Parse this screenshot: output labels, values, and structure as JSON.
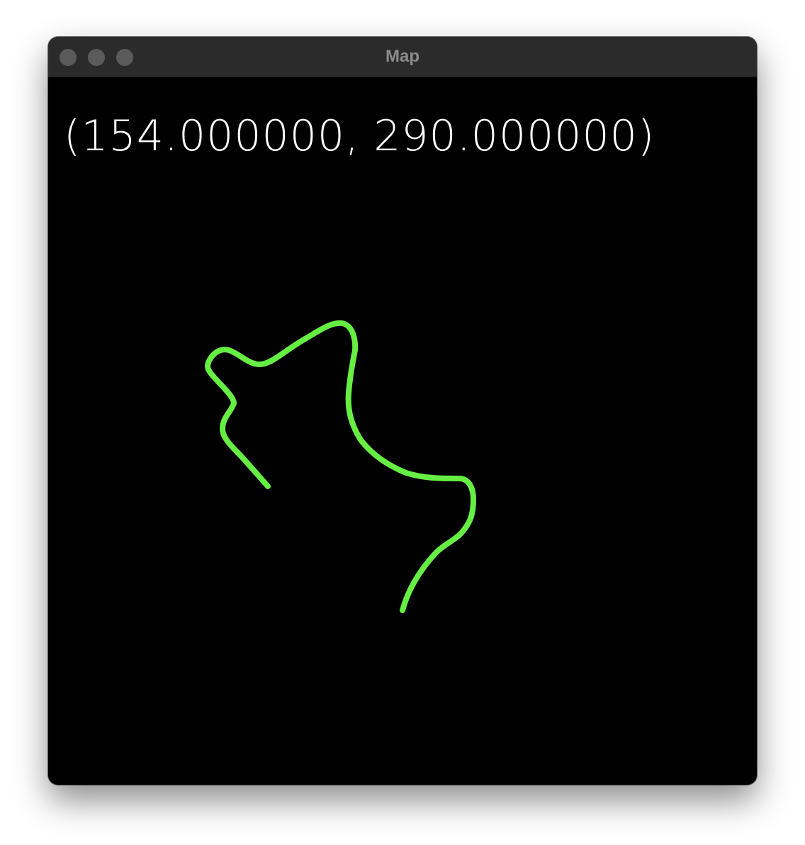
{
  "window": {
    "title": "Map",
    "controls": {
      "close_icon": "close-icon",
      "minimize_icon": "minimize-icon",
      "maximize_icon": "maximize-icon"
    }
  },
  "map": {
    "coordinate_readout": "(154.000000, 290.000000)",
    "path_color": "#66ee44",
    "background_color": "#000000",
    "text_color": "#ffffff"
  }
}
